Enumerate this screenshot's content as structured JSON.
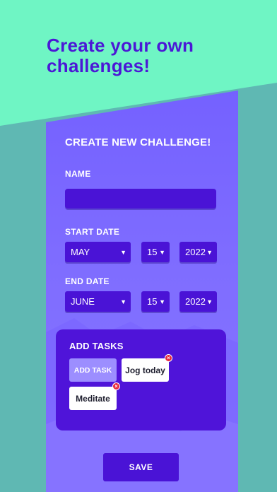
{
  "headline": "Create your own challenges!",
  "form": {
    "title": "CREATE NEW CHALLENGE!",
    "name_label": "NAME",
    "name_value": "",
    "start_label": "START DATE",
    "start": {
      "month": "MAY",
      "day": "15",
      "year": "2022"
    },
    "end_label": "END DATE",
    "end": {
      "month": "JUNE",
      "day": "15",
      "year": "2022"
    },
    "caret": "▼"
  },
  "tasks": {
    "title": "ADD TASKS",
    "add_label": "ADD TASK",
    "items": [
      "Jog today",
      "Meditate"
    ],
    "remove_glyph": "×"
  },
  "save_label": "SAVE",
  "colors": {
    "mint": "#6ff5c4",
    "teal": "#5fb8b3",
    "panel": "#7560ff",
    "deep_purple": "#4a13d6",
    "delete_red": "#e8283c"
  }
}
